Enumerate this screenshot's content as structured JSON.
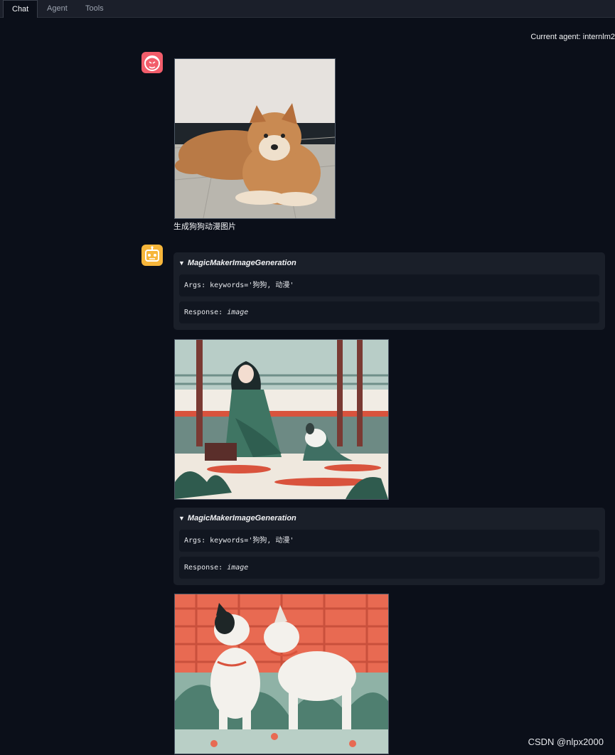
{
  "tabs": [
    {
      "label": "Chat",
      "active": true
    },
    {
      "label": "Agent",
      "active": false
    },
    {
      "label": "Tools",
      "active": false
    }
  ],
  "current_agent": "Current agent: internlm2",
  "user_message": {
    "avatar_icon": "user-face-icon",
    "text": "生成狗狗动漫图片",
    "photo_desc": "shiba-inu-photo"
  },
  "bot_message": {
    "avatar_icon": "robot-icon",
    "tool_calls": [
      {
        "name": "MagicMakerImageGeneration",
        "args_label": "Args: keywords=",
        "args_value": "'狗狗, 动漫'",
        "response_label": "Response: ",
        "response_value": "image"
      },
      {
        "name": "MagicMakerImageGeneration",
        "args_label": "Args: keywords=",
        "args_value": "'狗狗, 动漫'",
        "response_label": "Response: ",
        "response_value": "image"
      }
    ]
  },
  "watermark": "CSDN @nlpx2000",
  "colors": {
    "background": "#0b0f19",
    "user_avatar": "#f25d6b",
    "bot_avatar": "#f7b63b",
    "tool_panel": "#1a1f29"
  }
}
